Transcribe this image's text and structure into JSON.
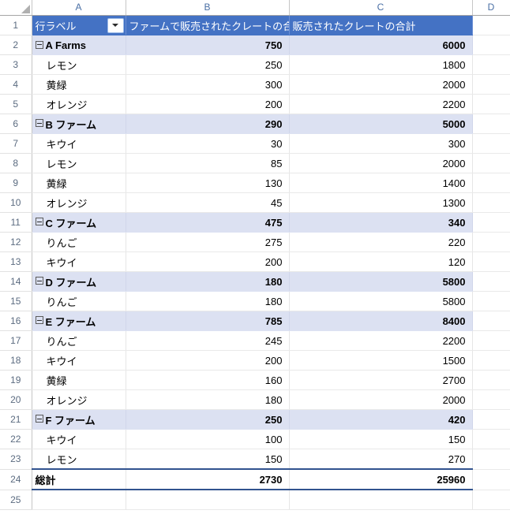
{
  "app": {
    "type": "spreadsheet-pivot-table"
  },
  "colors": {
    "header_fill": "#4472c4",
    "header_text": "#ffffff",
    "group_row_fill": "#dce1f2",
    "total_border": "#31538f",
    "gutter_text": "#5b6b80",
    "column_letter_text": "#4a6fa5"
  },
  "column_headers": [
    "A",
    "B",
    "C",
    "D"
  ],
  "row_numbers": [
    "1",
    "2",
    "3",
    "4",
    "5",
    "6",
    "7",
    "8",
    "9",
    "10",
    "11",
    "12",
    "13",
    "14",
    "15",
    "16",
    "17",
    "18",
    "19",
    "20",
    "21",
    "22",
    "23",
    "24",
    "25"
  ],
  "pivot": {
    "row_label_header": "行ラベル",
    "filter_icon": "chevron-down-icon",
    "value_headers": {
      "b": "ファームで販売されたクレートの合計",
      "c": "販売されたクレートの合計"
    },
    "rows": [
      {
        "row": "2",
        "kind": "group",
        "label": "A Farms",
        "b": "750",
        "c": "6000"
      },
      {
        "row": "3",
        "kind": "detail",
        "label": "レモン",
        "b": "250",
        "c": "1800"
      },
      {
        "row": "4",
        "kind": "detail",
        "label": "黄緑",
        "b": "300",
        "c": "2000"
      },
      {
        "row": "5",
        "kind": "detail",
        "label": "オレンジ",
        "b": "200",
        "c": "2200"
      },
      {
        "row": "6",
        "kind": "group",
        "label": "B ファーム",
        "b": "290",
        "c": "5000"
      },
      {
        "row": "7",
        "kind": "detail",
        "label": "キウイ",
        "b": "30",
        "c": "300"
      },
      {
        "row": "8",
        "kind": "detail",
        "label": "レモン",
        "b": "85",
        "c": "2000"
      },
      {
        "row": "9",
        "kind": "detail",
        "label": "黄緑",
        "b": "130",
        "c": "1400"
      },
      {
        "row": "10",
        "kind": "detail",
        "label": "オレンジ",
        "b": "45",
        "c": "1300"
      },
      {
        "row": "11",
        "kind": "group",
        "label": "C ファーム",
        "b": "475",
        "c": "340"
      },
      {
        "row": "12",
        "kind": "detail",
        "label": "りんご",
        "b": "275",
        "c": "220"
      },
      {
        "row": "13",
        "kind": "detail",
        "label": "キウイ",
        "b": "200",
        "c": "120"
      },
      {
        "row": "14",
        "kind": "group",
        "label": "D ファーム",
        "b": "180",
        "c": "5800"
      },
      {
        "row": "15",
        "kind": "detail",
        "label": "りんご",
        "b": "180",
        "c": "5800"
      },
      {
        "row": "16",
        "kind": "group",
        "label": "E ファーム",
        "b": "785",
        "c": "8400"
      },
      {
        "row": "17",
        "kind": "detail",
        "label": "りんご",
        "b": "245",
        "c": "2200"
      },
      {
        "row": "18",
        "kind": "detail",
        "label": "キウイ",
        "b": "200",
        "c": "1500"
      },
      {
        "row": "19",
        "kind": "detail",
        "label": "黄緑",
        "b": "160",
        "c": "2700"
      },
      {
        "row": "20",
        "kind": "detail",
        "label": "オレンジ",
        "b": "180",
        "c": "2000"
      },
      {
        "row": "21",
        "kind": "group",
        "label": "F ファーム",
        "b": "250",
        "c": "420"
      },
      {
        "row": "22",
        "kind": "detail",
        "label": "キウイ",
        "b": "100",
        "c": "150"
      },
      {
        "row": "23",
        "kind": "detail",
        "label": "レモン",
        "b": "150",
        "c": "270"
      },
      {
        "row": "24",
        "kind": "total",
        "label": "総計",
        "b": "2730",
        "c": "25960"
      }
    ]
  }
}
